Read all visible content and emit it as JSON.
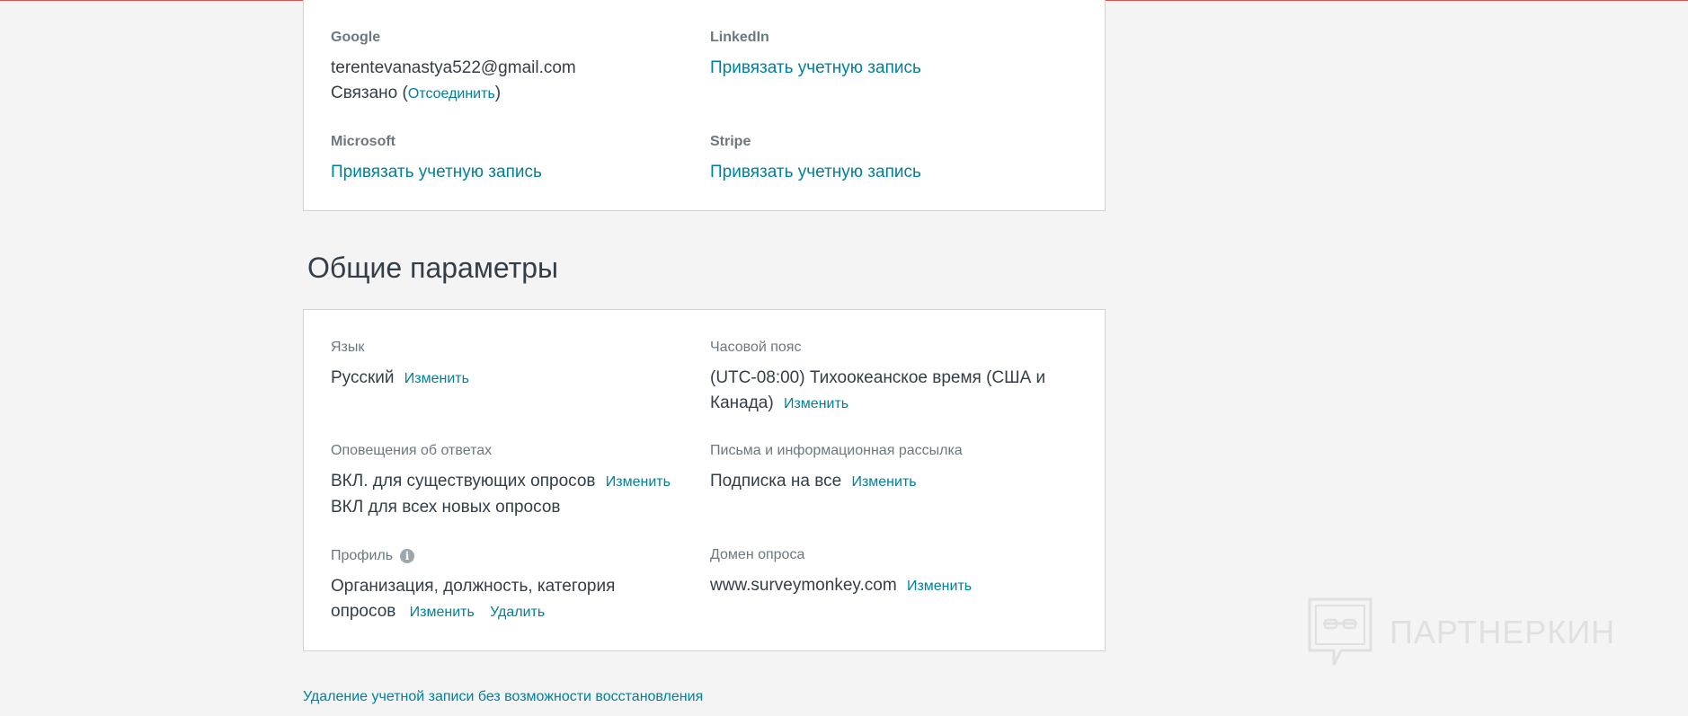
{
  "accounts": {
    "google": {
      "label": "Google",
      "email": "terentevanastya522@gmail.com",
      "status_prefix": "Связано (",
      "disconnect_label": "Отсоединить",
      "status_suffix": ")"
    },
    "linkedin": {
      "label": "LinkedIn",
      "link_label": "Привязать учетную запись"
    },
    "microsoft": {
      "label": "Microsoft",
      "link_label": "Привязать учетную запись"
    },
    "stripe": {
      "label": "Stripe",
      "link_label": "Привязать учетную запись"
    }
  },
  "general": {
    "title": "Общие параметры",
    "language": {
      "label": "Язык",
      "value": "Русский",
      "change_label": "Изменить"
    },
    "timezone": {
      "label": "Часовой пояс",
      "value_line1": "(UTC-08:00) Тихоокеанское время (США и",
      "value_line2": "Канада)",
      "change_label": "Изменить"
    },
    "notifications": {
      "label": "Оповещения об ответах",
      "value_line1": "ВКЛ. для существующих опросов",
      "value_line2": "ВКЛ для всех новых опросов",
      "change_label": "Изменить"
    },
    "newsletter": {
      "label": "Письма и информационная рассылка",
      "value": "Подписка на все",
      "change_label": "Изменить"
    },
    "profile": {
      "label": "Профиль",
      "info_icon": "i",
      "value_line1": "Организация, должность, категория",
      "value_line2": "опросов",
      "change_label": "Изменить",
      "delete_label": "Удалить"
    },
    "domain": {
      "label": "Домен опроса",
      "value": "www.surveymonkey.com",
      "change_label": "Изменить"
    }
  },
  "footer": {
    "delete_account_label": "Удаление учетной записи без возможности восстановления"
  },
  "watermark": {
    "text": "ПАРТНЕРКИН"
  },
  "colors": {
    "link": "#00819a",
    "text": "#333e48",
    "label": "#6b787f",
    "background": "#f4f4f4",
    "card": "#ffffff",
    "border": "#d0d2d3"
  }
}
